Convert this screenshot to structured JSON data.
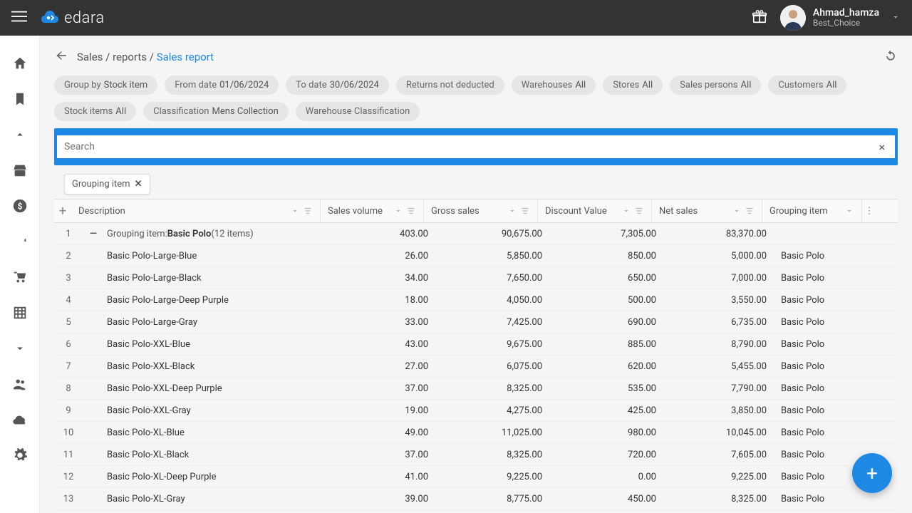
{
  "topbar": {
    "brand": "edara",
    "user_name": "Ahmad_hamza",
    "user_sub": "Best_Choice"
  },
  "breadcrumb": {
    "path1": "Sales",
    "path2": "reports",
    "active": "Sales report"
  },
  "filters": [
    {
      "label": "Group by",
      "value": "Stock item"
    },
    {
      "label": "From date",
      "value": "01/06/2024"
    },
    {
      "label": "To date",
      "value": "30/06/2024"
    },
    {
      "label": "Returns not deducted",
      "value": ""
    },
    {
      "label": "Warehouses",
      "value": "All"
    },
    {
      "label": "Stores",
      "value": "All"
    },
    {
      "label": "Sales persons",
      "value": "All"
    },
    {
      "label": "Customers",
      "value": "All"
    },
    {
      "label": "Stock items",
      "value": "All"
    },
    {
      "label": "Classification",
      "value": "Mens Collection"
    },
    {
      "label": "Warehouse Classification",
      "value": ""
    }
  ],
  "search": {
    "placeholder": "Search"
  },
  "grouping_tag": "Grouping item",
  "columns": {
    "description": "Description",
    "sales_volume": "Sales volume",
    "gross_sales": "Gross sales",
    "discount_value": "Discount Value",
    "net_sales": "Net sales",
    "grouping_item": "Grouping item"
  },
  "group_header": {
    "idx": "1",
    "prefix": "Grouping item:",
    "name": "Basic Polo",
    "count": "(12 items)",
    "vol": "403.00",
    "gross": "90,675.00",
    "disc": "7,305.00",
    "net": "83,370.00"
  },
  "rows": [
    {
      "idx": "2",
      "desc": "Basic Polo-Large-Blue",
      "vol": "26.00",
      "gross": "5,850.00",
      "disc": "850.00",
      "net": "5,000.00",
      "group": "Basic Polo"
    },
    {
      "idx": "3",
      "desc": "Basic Polo-Large-Black",
      "vol": "34.00",
      "gross": "7,650.00",
      "disc": "650.00",
      "net": "7,000.00",
      "group": "Basic Polo"
    },
    {
      "idx": "4",
      "desc": "Basic Polo-Large-Deep Purple",
      "vol": "18.00",
      "gross": "4,050.00",
      "disc": "500.00",
      "net": "3,550.00",
      "group": "Basic Polo"
    },
    {
      "idx": "5",
      "desc": "Basic Polo-Large-Gray",
      "vol": "33.00",
      "gross": "7,425.00",
      "disc": "690.00",
      "net": "6,735.00",
      "group": "Basic Polo"
    },
    {
      "idx": "6",
      "desc": "Basic Polo-XXL-Blue",
      "vol": "43.00",
      "gross": "9,675.00",
      "disc": "885.00",
      "net": "8,790.00",
      "group": "Basic Polo"
    },
    {
      "idx": "7",
      "desc": "Basic Polo-XXL-Black",
      "vol": "27.00",
      "gross": "6,075.00",
      "disc": "620.00",
      "net": "5,455.00",
      "group": "Basic Polo"
    },
    {
      "idx": "8",
      "desc": "Basic Polo-XXL-Deep Purple",
      "vol": "37.00",
      "gross": "8,325.00",
      "disc": "535.00",
      "net": "7,790.00",
      "group": "Basic Polo"
    },
    {
      "idx": "9",
      "desc": "Basic Polo-XXL-Gray",
      "vol": "19.00",
      "gross": "4,275.00",
      "disc": "425.00",
      "net": "3,850.00",
      "group": "Basic Polo"
    },
    {
      "idx": "10",
      "desc": "Basic Polo-XL-Blue",
      "vol": "49.00",
      "gross": "11,025.00",
      "disc": "980.00",
      "net": "10,045.00",
      "group": "Basic Polo"
    },
    {
      "idx": "11",
      "desc": "Basic Polo-XL-Black",
      "vol": "37.00",
      "gross": "8,325.00",
      "disc": "720.00",
      "net": "7,605.00",
      "group": "Basic Polo"
    },
    {
      "idx": "12",
      "desc": "Basic Polo-XL-Deep Purple",
      "vol": "41.00",
      "gross": "9,225.00",
      "disc": "0.00",
      "net": "9,225.00",
      "group": "Basic Polo"
    },
    {
      "idx": "13",
      "desc": "Basic Polo-XL-Gray",
      "vol": "39.00",
      "gross": "8,775.00",
      "disc": "450.00",
      "net": "8,325.00",
      "group": "Basic Polo"
    }
  ]
}
